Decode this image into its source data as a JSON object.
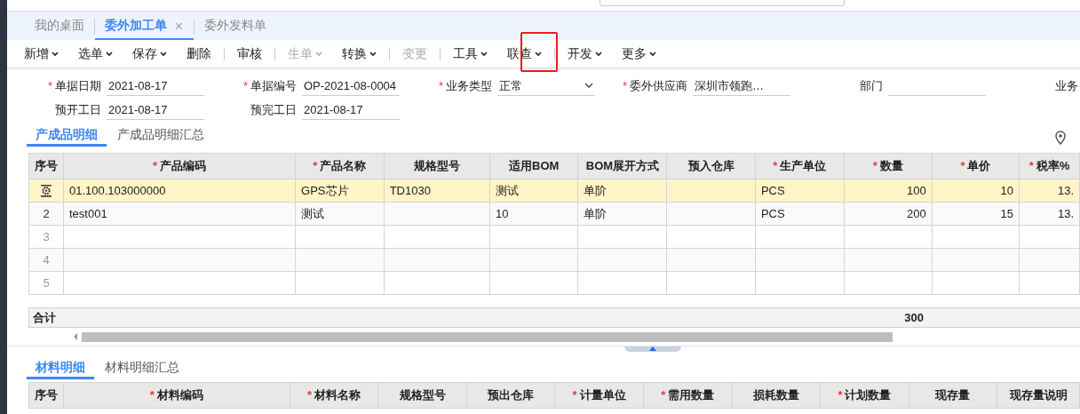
{
  "tabs": [
    {
      "label": "我的桌面",
      "selected": false,
      "closable": false
    },
    {
      "label": "委外加工单",
      "selected": true,
      "closable": true
    },
    {
      "label": "委外发料单",
      "selected": false,
      "closable": false
    }
  ],
  "close_glyph": "✕",
  "required_mark": "*",
  "toolbar": [
    {
      "kind": "button",
      "label": "新增",
      "dropdown": true,
      "disabled": false
    },
    {
      "kind": "button",
      "label": "选单",
      "dropdown": true,
      "disabled": false
    },
    {
      "kind": "button",
      "label": "保存",
      "dropdown": true,
      "disabled": false
    },
    {
      "kind": "button",
      "label": "删除",
      "dropdown": false,
      "disabled": false
    },
    {
      "kind": "separator"
    },
    {
      "kind": "button",
      "label": "审核",
      "dropdown": false,
      "disabled": false
    },
    {
      "kind": "separator"
    },
    {
      "kind": "button",
      "label": "生单",
      "dropdown": true,
      "disabled": true
    },
    {
      "kind": "button",
      "label": "转换",
      "dropdown": true,
      "disabled": false
    },
    {
      "kind": "separator"
    },
    {
      "kind": "button",
      "label": "变更",
      "dropdown": false,
      "disabled": true
    },
    {
      "kind": "separator"
    },
    {
      "kind": "button",
      "label": "工具",
      "dropdown": true,
      "disabled": false
    },
    {
      "kind": "button",
      "label": "联查",
      "dropdown": true,
      "disabled": false
    },
    {
      "kind": "separator"
    },
    {
      "kind": "button",
      "label": "开发",
      "dropdown": true,
      "disabled": false
    },
    {
      "kind": "button",
      "label": "更多",
      "dropdown": true,
      "disabled": false
    }
  ],
  "form": [
    [
      {
        "kind": "text",
        "label": "单据日期",
        "required": true,
        "value": "2021-08-17"
      },
      {
        "kind": "text",
        "label": "单据编号",
        "required": true,
        "value": "OP-2021-08-0004"
      },
      {
        "kind": "select",
        "label": "业务类型",
        "required": true,
        "value": "正常"
      },
      {
        "kind": "text",
        "label": "委外供应商",
        "required": true,
        "value": "深圳市领跑…"
      },
      {
        "kind": "text",
        "label": "部门",
        "required": false
      },
      {
        "kind": "label",
        "label": "业务",
        "required": false
      }
    ],
    [
      {
        "kind": "text",
        "label": "预开工日",
        "required": false,
        "value": "2021-08-17"
      },
      {
        "kind": "text",
        "label": "预完工日",
        "required": false,
        "value": "2021-08-17"
      }
    ]
  ],
  "product_tabs": [
    {
      "label": "产成品明细",
      "selected": true
    },
    {
      "label": "产成品明细汇总",
      "selected": false
    }
  ],
  "product_table": {
    "columns": [
      {
        "label": "序号",
        "required": false
      },
      {
        "label": "产品编码",
        "required": true
      },
      {
        "label": "产品名称",
        "required": true
      },
      {
        "label": "规格型号",
        "required": false
      },
      {
        "label": "适用BOM",
        "required": false
      },
      {
        "label": "BOM展开方式",
        "required": false
      },
      {
        "label": "预入仓库",
        "required": false
      },
      {
        "label": "生产单位",
        "required": true
      },
      {
        "label": "数量",
        "required": true,
        "total": "300"
      },
      {
        "label": "单价",
        "required": true
      },
      {
        "label": "税率%",
        "required": true
      }
    ],
    "rows": [
      {
        "selected": true,
        "cells": [
          "01.100.103000000",
          "GPS芯片",
          "TD1030",
          "测试",
          "单阶",
          "",
          "PCS",
          "100",
          "10",
          "13."
        ]
      },
      {
        "selected": false,
        "row_number": "2",
        "cells": [
          "test001",
          "测试",
          "",
          "10",
          "单阶",
          "",
          "PCS",
          "200",
          "15",
          "13."
        ]
      },
      {
        "selected": false,
        "row_number": "3"
      },
      {
        "selected": false,
        "row_number": "4"
      },
      {
        "selected": false,
        "row_number": "5"
      }
    ],
    "total_label": "合计"
  },
  "material_tabs": [
    {
      "label": "材料明细",
      "selected": true
    },
    {
      "label": "材料明细汇总",
      "selected": false
    }
  ],
  "material_table": {
    "columns": [
      {
        "label": "序号",
        "required": false
      },
      {
        "label": "材料编码",
        "required": true
      },
      {
        "label": "材料名称",
        "required": true
      },
      {
        "label": "规格型号",
        "required": false
      },
      {
        "label": "预出仓库",
        "required": false
      },
      {
        "label": "计量单位",
        "required": true
      },
      {
        "label": "需用数量",
        "required": true
      },
      {
        "label": "损耗数量",
        "required": false
      },
      {
        "label": "计划数量",
        "required": true
      },
      {
        "label": "现存量",
        "required": false
      },
      {
        "label": "现存量说明",
        "required": false
      }
    ]
  }
}
